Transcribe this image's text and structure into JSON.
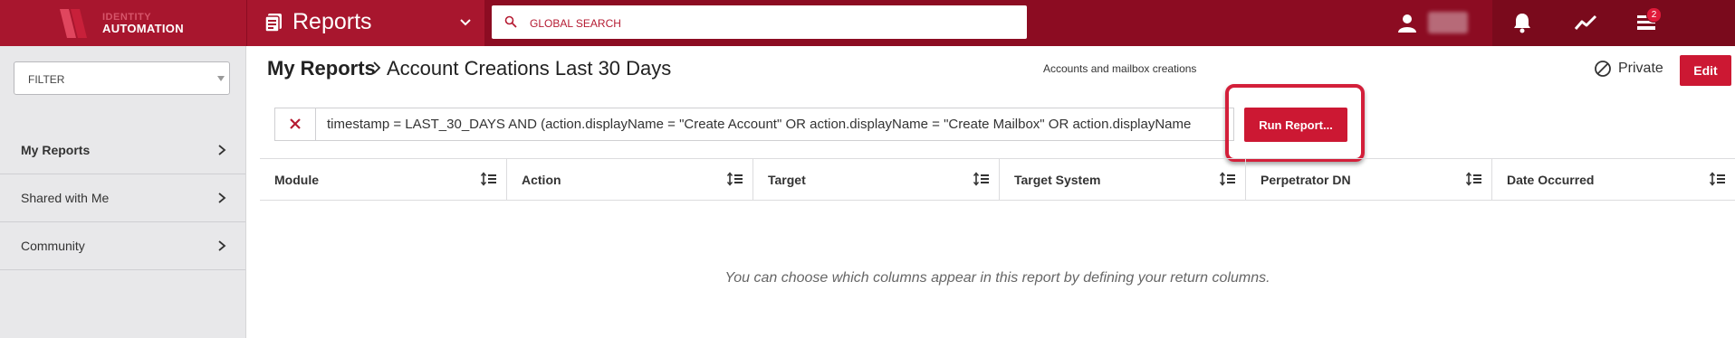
{
  "brand": {
    "line1": "IDENTITY",
    "line2": "AUTOMATION",
    "color": "#a8162e"
  },
  "app": {
    "title": "Reports"
  },
  "search": {
    "placeholder": "GLOBAL SEARCH"
  },
  "nav": {
    "tasks_badge": "2"
  },
  "sidebar": {
    "filter_label": "FILTER",
    "items": [
      {
        "label": "My Reports"
      },
      {
        "label": "Shared with Me"
      },
      {
        "label": "Community"
      }
    ]
  },
  "header": {
    "crumb_root": "My Reports",
    "crumb_current": "Account Creations Last 30 Days",
    "description": "Accounts and mailbox creations",
    "private_label": "Private",
    "edit_label": "Edit"
  },
  "query": {
    "text": "timestamp = LAST_30_DAYS AND (action.displayName = \"Create Account\" OR action.displayName = \"Create Mailbox\" OR action.displayName",
    "run_label": "Run Report..."
  },
  "table": {
    "columns": [
      "Module",
      "Action",
      "Target",
      "Target System",
      "Perpetrator DN",
      "Date Occurred"
    ],
    "empty_message": "You can choose which columns appear in this report by defining your return columns."
  }
}
